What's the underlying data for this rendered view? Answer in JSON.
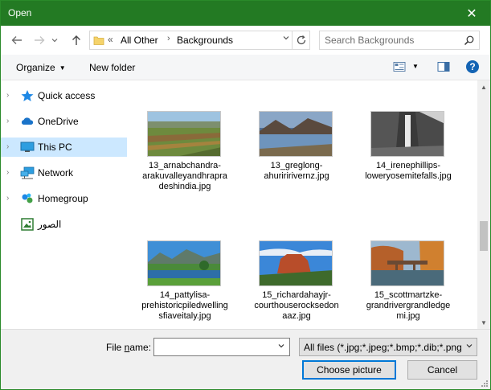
{
  "window": {
    "title": "Open",
    "close_glyph": "✕"
  },
  "nav": {
    "back_icon": "arrow-left-icon",
    "forward_icon": "arrow-right-icon",
    "up_icon": "arrow-up-icon",
    "address": {
      "overflow": "«",
      "crumbs": [
        "All Other",
        "Backgrounds"
      ],
      "separator": "›"
    },
    "search_placeholder": "Search Backgrounds"
  },
  "toolbar": {
    "organize_label": "Organize",
    "new_folder_label": "New folder",
    "help_label": "?"
  },
  "sidebar": {
    "items": [
      {
        "label": "Quick access",
        "icon": "star-icon"
      },
      {
        "label": "OneDrive",
        "icon": "cloud-icon"
      },
      {
        "label": "This PC",
        "icon": "monitor-icon",
        "selected": true
      },
      {
        "label": "Network",
        "icon": "network-icon"
      },
      {
        "label": "Homegroup",
        "icon": "homegroup-icon"
      },
      {
        "label": "الصور",
        "icon": "pictures-icon"
      }
    ]
  },
  "files": [
    {
      "name": "13_arnabchandra-arakuvalleyandhrapradeshindia.jpg"
    },
    {
      "name": "13_greglong-ahuriririvernz.jpg"
    },
    {
      "name": "14_irenephillips-loweryosemitefalls.jpg"
    },
    {
      "name": "14_pattylisa-prehistoricpiledwellingsfiaveitaly.jpg"
    },
    {
      "name": "15_richardahayjr-courthouserocksedonaaz.jpg"
    },
    {
      "name": "15_scottmartzke-grandrivergrandledgemi.jpg"
    }
  ],
  "bottom": {
    "file_name_label_pre": "File ",
    "file_name_label_u": "n",
    "file_name_label_post": "ame:",
    "file_name_value": "",
    "filter_value": "All files (*.jpg;*.jpeg;*.bmp;*.dib;*.png",
    "choose_label": "Choose picture",
    "cancel_label": "Cancel"
  },
  "colors": {
    "titlebar": "#237a23",
    "selection": "#cce8ff",
    "accent": "#0078d7"
  }
}
